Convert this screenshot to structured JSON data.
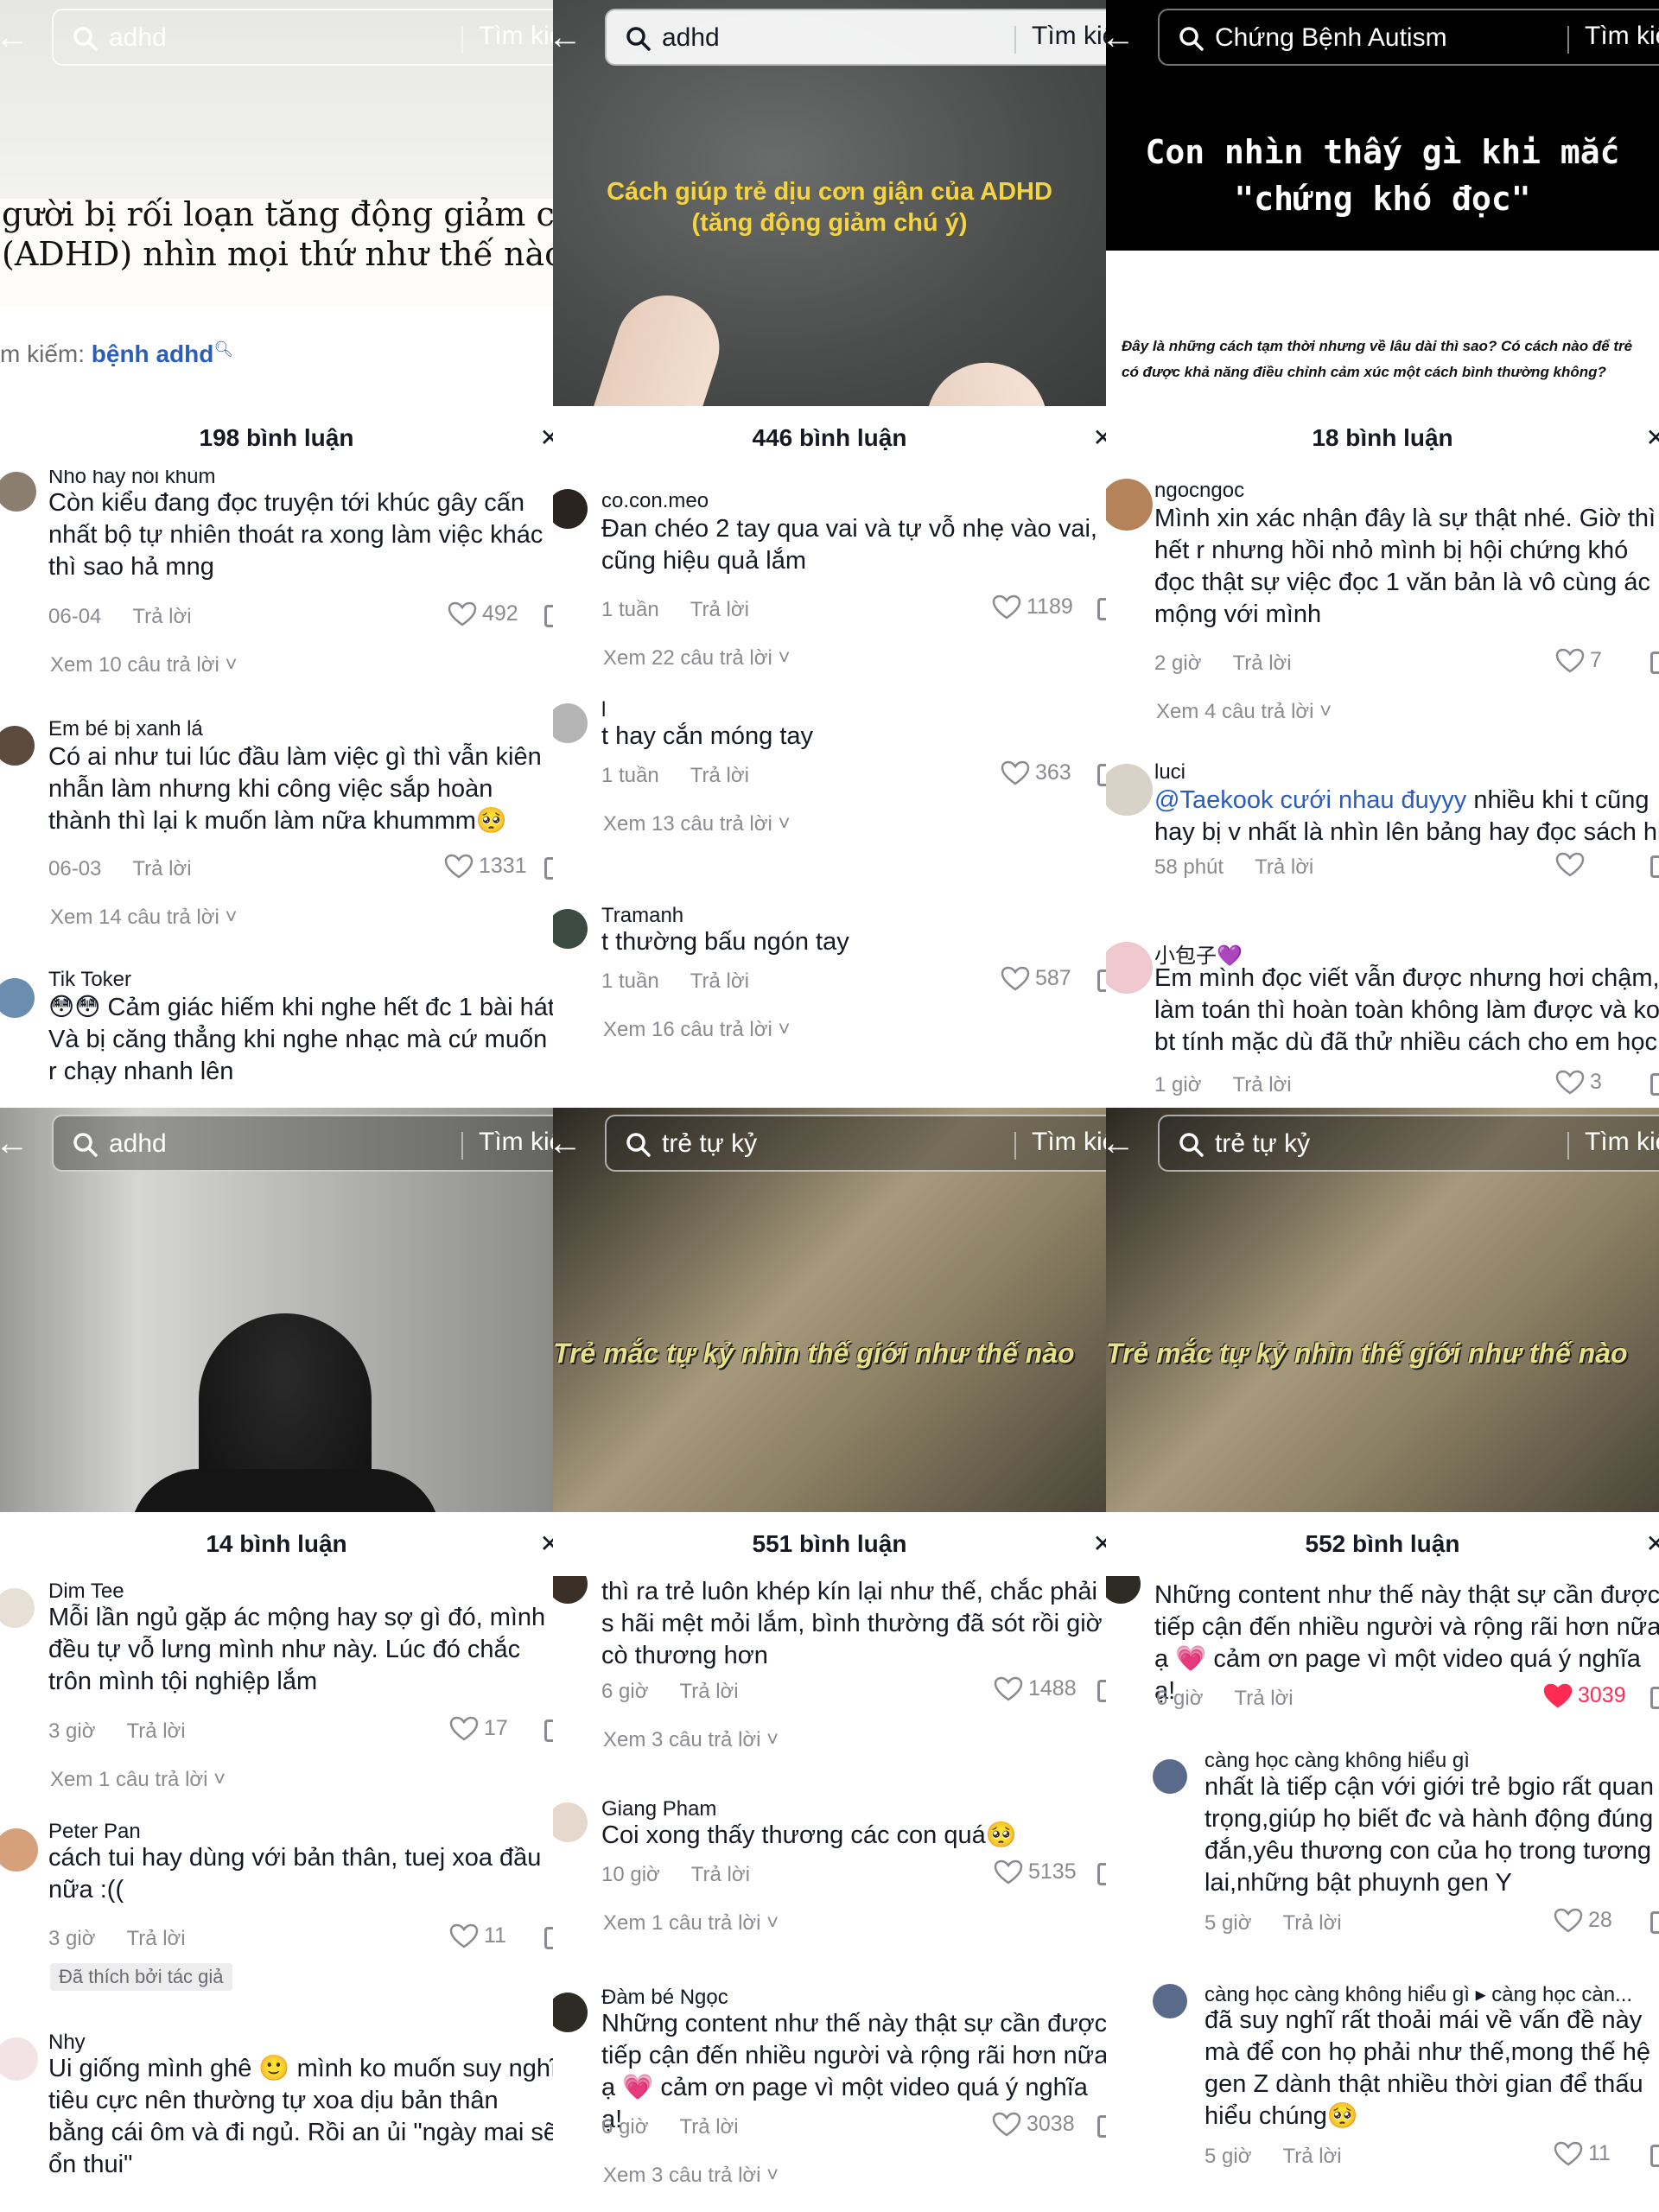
{
  "search_button": "Tìm kiếm",
  "panels": [
    {
      "query": "adhd",
      "overlay_lines": [
        "gười bị rối loạn tăng động giảm chú",
        "(ADHD) nhìn mọi thứ như thế nào"
      ],
      "suggest_prefix": "m kiếm:",
      "suggest_term": "bệnh adhd",
      "comment_count": "198 bình luận",
      "comments": [
        {
          "user": "Nho hay nói khùm",
          "text": "Còn kiểu đang đọc truyện tới khúc gây cấn nhất bộ tự nhiên thoát ra xong làm việc khác thì sao hả mng",
          "time": "06-04",
          "reply": "Trả lời",
          "likes": "492",
          "view": "Xem 10 câu trả lời ˅"
        },
        {
          "user": "Em bé bị xanh lá",
          "text": "Có ai như tui lúc đầu làm việc gì thì vẫn kiên nhẫn làm nhưng khi công việc sắp hoàn thành thì lại k muốn làm nữa khummm🥺",
          "time": "06-03",
          "reply": "Trả lời",
          "likes": "1331",
          "view": "Xem 14 câu trả lời ˅"
        },
        {
          "user": "Tik Toker",
          "text": "😳😳 Cảm giác hiếm khi nghe hết đc 1 bài hát Và bị căng thẳng khi nghe nhạc mà cứ muốn r chạy nhanh lên",
          "time": "",
          "reply": "",
          "likes": "",
          "view": ""
        }
      ]
    },
    {
      "query": "adhd",
      "overlay_lines": [
        "Cách giúp trẻ dịu cơn giận của ADHD",
        "(tăng động giảm chú ý)"
      ],
      "comment_count": "446 bình luận",
      "comments": [
        {
          "user": "co.con.meo",
          "text": "Đan chéo 2 tay qua vai và tự vỗ nhẹ vào vai, cũng hiệu quả lắm",
          "time": "1 tuần",
          "reply": "Trả lời",
          "likes": "1189",
          "view": "Xem 22 câu trả lời ˅"
        },
        {
          "user": "l",
          "text": "t hay cắn móng tay",
          "time": "1 tuần",
          "reply": "Trả lời",
          "likes": "363",
          "view": "Xem 13 câu trả lời ˅"
        },
        {
          "user": "Tramanh",
          "text": "t thường bấu ngón tay",
          "time": "1 tuần",
          "reply": "Trả lời",
          "likes": "587",
          "view": "Xem 16 câu trả lời ˅"
        }
      ]
    },
    {
      "query": "Chứng Bệnh Autism",
      "overlay_lines": [
        "Con nhìn thấy gì khi mắc",
        "\"chứng khó đọc\""
      ],
      "caption": "Đây là những cách tạm thời nhưng về lâu dài thì sao? Có cách nào để trẻ có được khả năng điều chỉnh cảm xúc một cách bình thường không?",
      "comment_count": "18 bình luận",
      "comments": [
        {
          "user": "ngocngoc",
          "text": "Mình xin xác nhận đây là sự thật nhé. Giờ thì hết r nhưng hồi nhỏ mình bị hội chứng khó đọc thật sự việc đọc 1 văn bản là vô cùng ác mộng với mình",
          "time": "2 giờ",
          "reply": "Trả lời",
          "likes": "7",
          "view": "Xem 4 câu trả lời ˅"
        },
        {
          "user": "luci",
          "mention": "@Taekook cưới nhau đuyyy",
          "text": " nhiều khi t cũng hay bị v nhất là nhìn lên bảng hay đọc sách hi",
          "time": "58 phút",
          "reply": "Trả lời",
          "likes": "",
          "view": ""
        },
        {
          "user": "小包子💜",
          "text": "Em mình đọc viết vẫn được nhưng hơi chậm, làm toán thì hoàn toàn không làm được và ko bt tính mặc dù đã thử nhiều cách cho em học",
          "time": "1 giờ",
          "reply": "Trả lời",
          "likes": "3",
          "view": ""
        }
      ]
    },
    {
      "query": "adhd",
      "comment_count": "14 bình luận",
      "comments": [
        {
          "user": "Dim Tee",
          "text": "Mỗi lần ngủ gặp ác mộng hay sợ gì đó, mình đều tự vỗ lưng mình như này. Lúc đó chắc trôn mình tội nghiệp lắm",
          "time": "3 giờ",
          "reply": "Trả lời",
          "likes": "17",
          "view": "Xem 1 câu trả lời ˅"
        },
        {
          "user": "Peter Pan",
          "text": "cách tui hay dùng với bản thân, tuej xoa đầu nữa :((",
          "time": "3 giờ",
          "reply": "Trả lời",
          "likes": "11",
          "badge": "Đã thích bởi tác giả"
        },
        {
          "user": "Nhy",
          "text": "Ui giống mình ghê 🙂 mình ko muốn suy nghĩ tiêu cực nên thường tự xoa dịu bản thân bằng cái ôm và đi ngủ. Rồi an ủi \"ngày mai sẽ ổn thui\""
        }
      ]
    },
    {
      "query": "trẻ tự kỷ",
      "overlay_lines": [
        "Trẻ mắc tự kỷ nhìn thế giới như thế nào"
      ],
      "comment_count": "551 bình luận",
      "comments": [
        {
          "user": "",
          "text": "thì ra trẻ luôn khép kín lại như thế, chắc phải s hãi mệt mỏi lắm, bình thường đã sót rồi giờ cò thương hơn",
          "time": "6 giờ",
          "reply": "Trả lời",
          "likes": "1488",
          "view": "Xem 3 câu trả lời ˅"
        },
        {
          "user": "Giang Pham",
          "text": "Coi xong thấy thương các con quá🥺",
          "time": "10 giờ",
          "reply": "Trả lời",
          "likes": "5135",
          "view": "Xem 1 câu trả lời ˅"
        },
        {
          "user": "Đàm  bé  Ngọc",
          "text": "Những content như thế này thật sự cần được tiếp cận đến nhiều người và rộng rãi hơn nữa ạ 💗 cảm ơn page vì một video quá ý nghĩa ạ!",
          "time": "6 giờ",
          "reply": "Trả lời",
          "likes": "3038",
          "view": "Xem 3 câu trả lời ˅"
        }
      ]
    },
    {
      "query": "trẻ tự kỷ",
      "overlay_lines": [
        "Trẻ mắc tự kỷ nhìn thế giới như thế nào"
      ],
      "comment_count": "552 bình luận",
      "comments": [
        {
          "user": "",
          "text": "Những content như thế này thật sự cần được tiếp cận đến nhiều người và rộng rãi hơn nữa ạ 💗 cảm ơn page vì một video quá ý nghĩa ạ!",
          "time": "6 giờ",
          "reply": "Trả lời",
          "likes": "3039",
          "liked": true
        },
        {
          "user": "càng học càng không hiểu gì",
          "text": "nhất là tiếp cận với giới trẻ bgio rất quan trọng,giúp họ biết đc và hành động đúng đắn,yêu thương con của họ trong tương lai,những bật phuynh gen Y",
          "time": "5 giờ",
          "reply": "Trả lời",
          "likes": "28"
        },
        {
          "user": "càng học càng không hiểu gì ▸ càng học càn...",
          "text": "đã suy nghĩ rất thoải mái về vấn đề này mà để con họ phải như thế,mong thế hệ gen Z dành thật nhiều thời gian để thấu hiểu chúng🥺",
          "time": "5 giờ",
          "reply": "Trả lời",
          "likes": "11"
        }
      ]
    }
  ]
}
